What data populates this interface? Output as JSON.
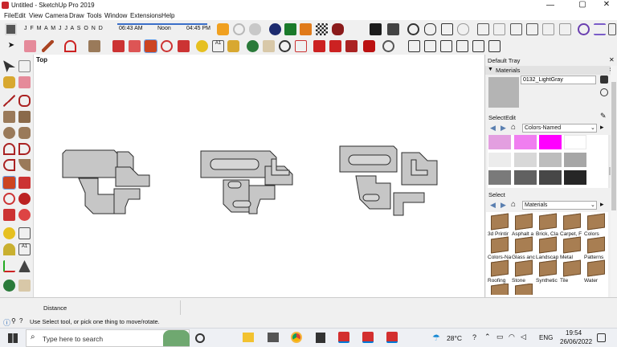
{
  "window": {
    "title": "Untitled - SketchUp Pro 2019"
  },
  "menu": [
    "File",
    "Edit",
    "View",
    "Camera",
    "Draw",
    "Tools",
    "Window",
    "Extensions",
    "Help"
  ],
  "shadow": {
    "months": "J F M A M J J A S O N D",
    "time_start": "06:43 AM",
    "time_mid": "Noon",
    "time_end": "04:45 PM"
  },
  "viewport": {
    "view_label": "Top"
  },
  "tray": {
    "title": "Default Tray",
    "materials_label": "Materials",
    "material_name": "0132_LightGray",
    "select_tab": "Select",
    "edit_tab": "Edit",
    "library": "Colors-Named",
    "swatches": [
      "#e39fe0",
      "#f07ef0",
      "#ff00ff",
      "#ffffff",
      "#ececec",
      "#d8d8d8",
      "#bdbdbd",
      "#a6a6a6",
      "#7a7a7a",
      "#616161",
      "#474747",
      "#262626"
    ],
    "select_label": "Select",
    "collection": "Materials",
    "folders": [
      "3d Printir",
      "Asphalt a",
      "Brick, Cla",
      "Carpet, F",
      "Colors",
      "Colors-Na",
      "Glass anc",
      "Landscap",
      "Metal",
      "Patterns",
      "Roofing",
      "Stone",
      "Synthetic",
      "Tile",
      "Water"
    ]
  },
  "status": {
    "measure_label": "Distance",
    "hint": "Use Select tool, or pick one thing to move/rotate."
  },
  "taskbar": {
    "search_placeholder": "Type here to search",
    "temperature": "28°C",
    "language": "ENG",
    "time": "19:54",
    "date": "26/06/2022"
  },
  "colors": {
    "shape_fill": "#c6c6c6",
    "shape_stroke": "#2c2c2c",
    "accent": "#0078d7"
  }
}
